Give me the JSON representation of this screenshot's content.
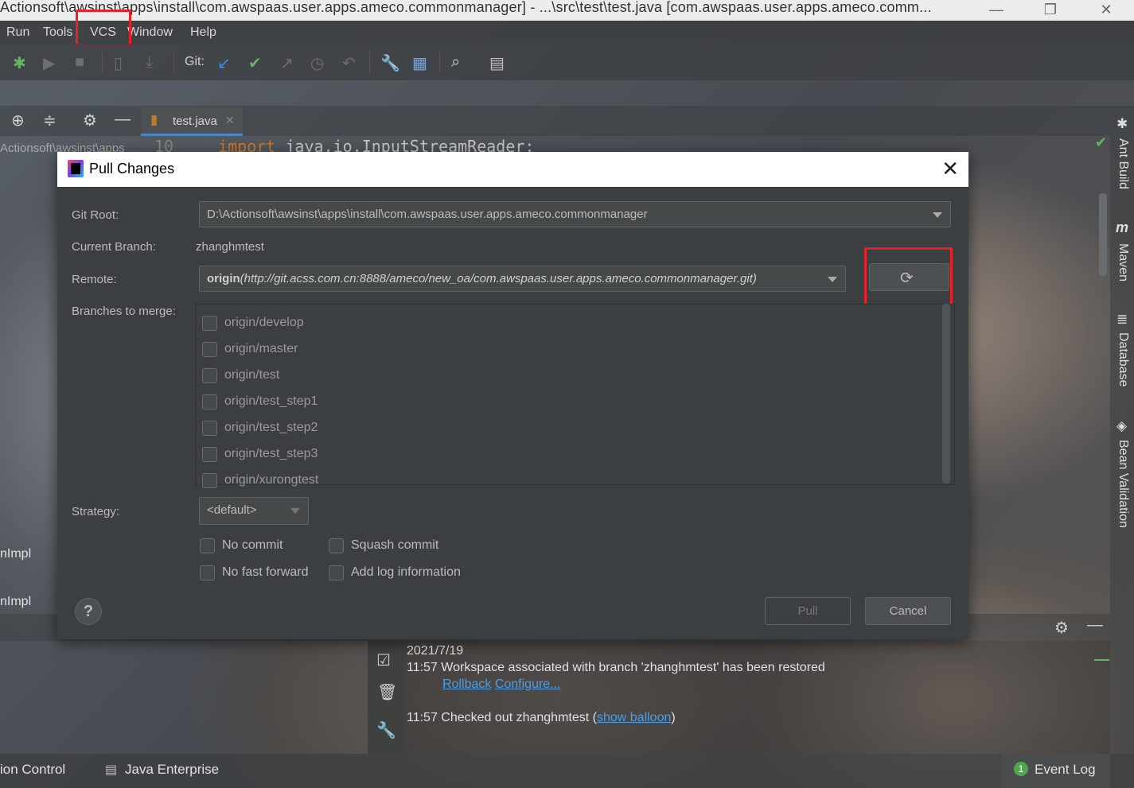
{
  "window": {
    "title": "Actionsoft\\awsinst\\apps\\install\\com.awspaas.user.apps.ameco.commonmanager] - ...\\src\\test\\test.java [com.awspaas.user.apps.ameco.comm..."
  },
  "menu": {
    "items": [
      "Run",
      "Tools",
      "VCS",
      "Window",
      "Help"
    ]
  },
  "toolbar": {
    "git_label": "Git:"
  },
  "editor": {
    "tab_label": "test.java",
    "path_fragment": "Actionsoft\\awsinst\\apps",
    "line_number": "10",
    "code_keyword": "import",
    "code_rest": " java.io.InputStreamReader;"
  },
  "right_tools": [
    "Ant Build",
    "Maven",
    "Database",
    "Bean Validation"
  ],
  "dialog": {
    "title": "Pull Changes",
    "git_root_label": "Git Root:",
    "git_root_value": "D:\\Actionsoft\\awsinst\\apps\\install\\com.awspaas.user.apps.ameco.commonmanager",
    "current_branch_label": "Current Branch:",
    "current_branch_value": "zhanghmtest",
    "remote_label": "Remote:",
    "remote_name": "origin",
    "remote_url": "(http://git.acss.com.cn:8888/ameco/new_oa/com.awspaas.user.apps.ameco.commonmanager.git)",
    "branches_label": "Branches to merge:",
    "branches": [
      "origin/develop",
      "origin/master",
      "origin/test",
      "origin/test_step1",
      "origin/test_step2",
      "origin/test_step3",
      "origin/xurongtest"
    ],
    "strategy_label": "Strategy:",
    "strategy_value": "<default>",
    "options": {
      "no_commit": "No commit",
      "squash_commit": "Squash commit",
      "no_fast_forward": "No fast forward",
      "add_log": "Add log information"
    },
    "help_label": "?",
    "pull_label": "Pull",
    "cancel_label": "Cancel"
  },
  "left_fragments": [
    "nImpl",
    "nImpl"
  ],
  "event_log": {
    "date": "2021/7/19",
    "line1": "11:57 Workspace associated with branch 'zhanghmtest' has been restored",
    "link_rollback": "Rollback",
    "link_configure": "Configure...",
    "line2_prefix": "11:57 Checked out zhanghmtest (",
    "link_show_balloon": "show balloon",
    "line2_suffix": ")"
  },
  "statusbar": {
    "version_control": "ion Control",
    "java_enterprise": "Java Enterprise",
    "event_log_count": "1",
    "event_log_label": "Event Log"
  }
}
